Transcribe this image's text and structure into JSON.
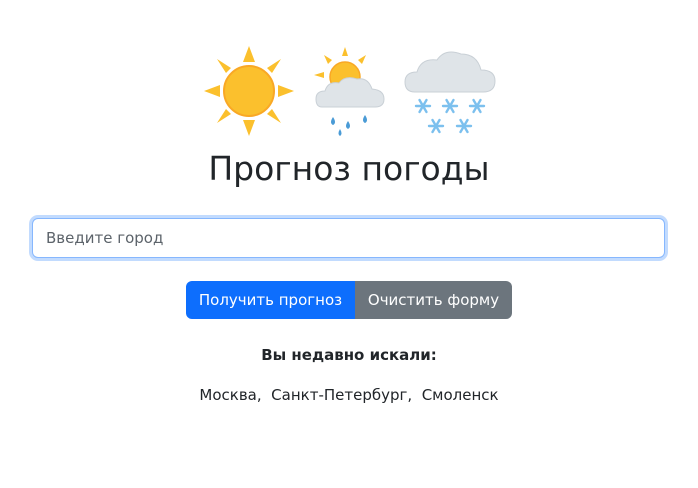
{
  "header": {
    "icons": [
      "sun-icon",
      "sun-behind-rain-cloud-icon",
      "snow-cloud-icon"
    ],
    "title": "Прогноз погоды"
  },
  "search": {
    "placeholder": "Введите город",
    "value": ""
  },
  "buttons": {
    "get_forecast": "Получить прогноз",
    "clear_form": "Очистить форму"
  },
  "recent": {
    "heading": "Вы недавно искали:",
    "cities": [
      "Москва",
      "Санкт-Петербург",
      "Смоленск"
    ],
    "separator": ",  "
  },
  "colors": {
    "primary": "#0d6efd",
    "secondary": "#6c757d",
    "sun": "#fbc02d",
    "cloud": "#dfe4e8",
    "rain": "#4a9bd6",
    "snow": "#7cc0ee"
  }
}
